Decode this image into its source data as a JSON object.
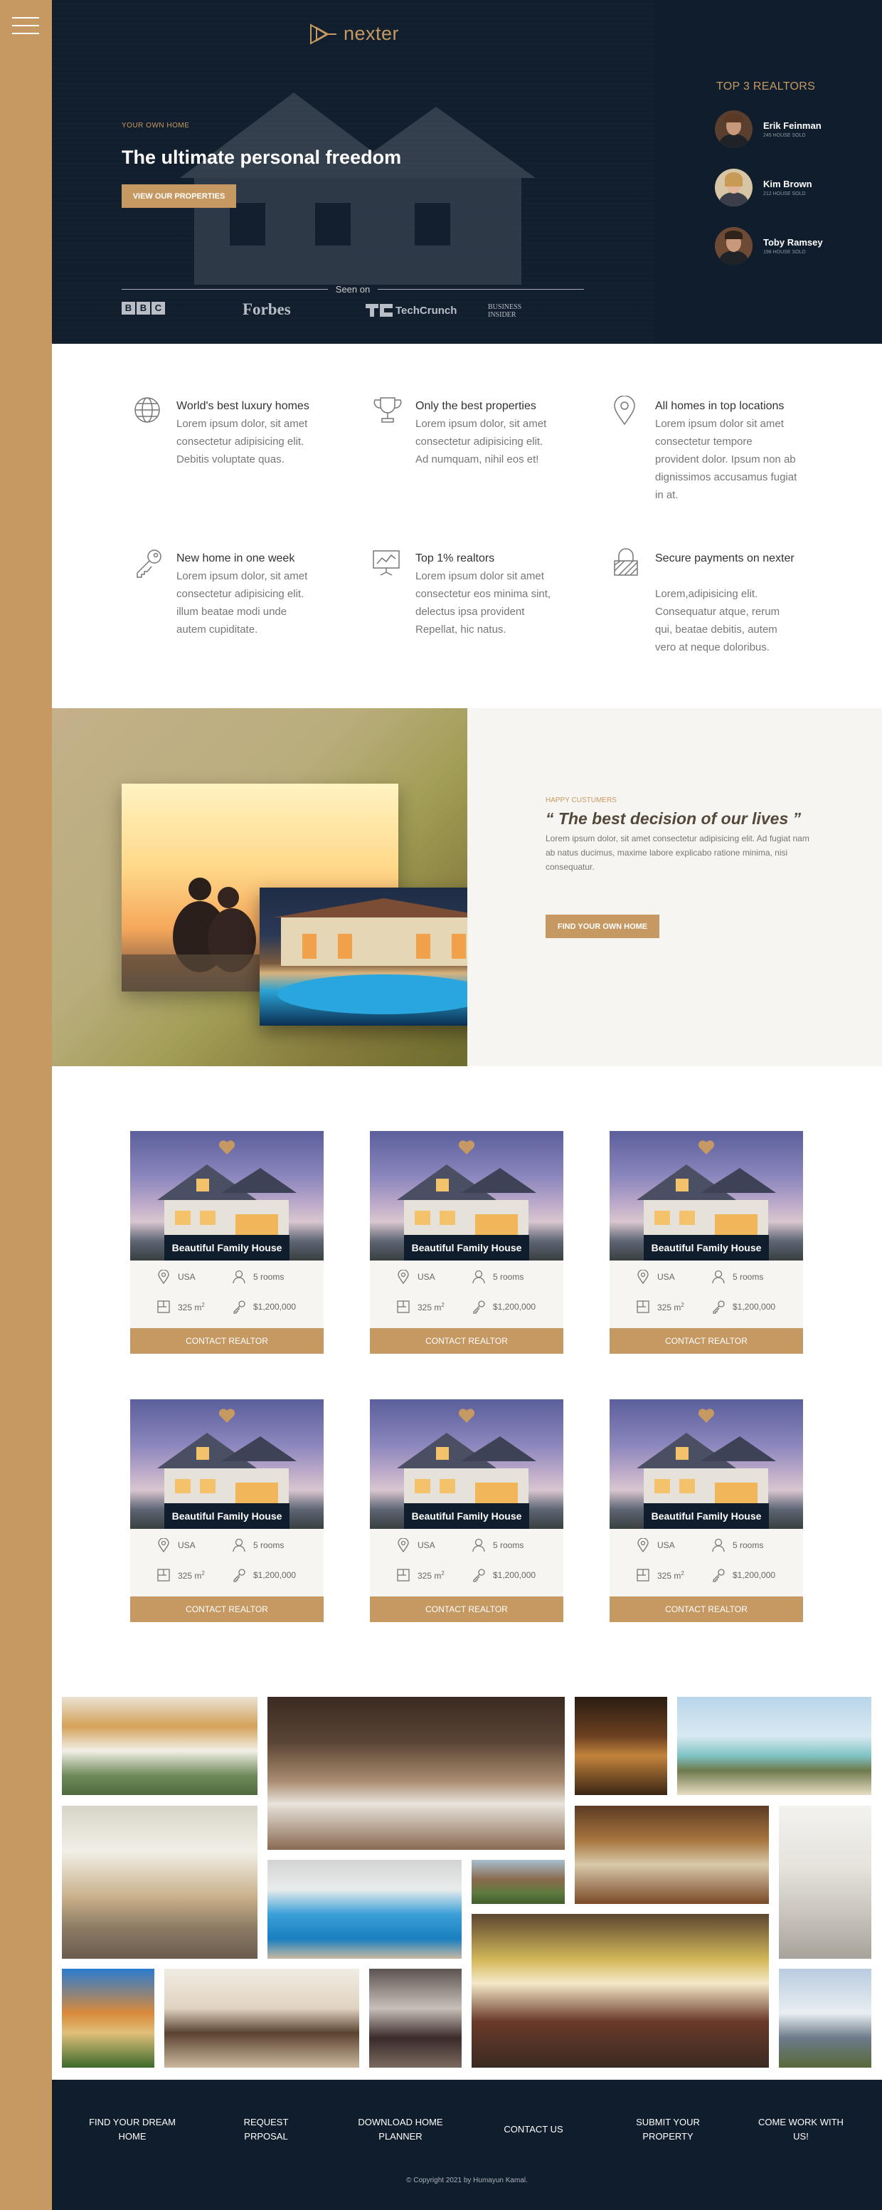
{
  "brand": {
    "name": "nexter",
    "accent": "#c69963",
    "dark": "#101d2c"
  },
  "sidebar": {
    "menu_icon": "hamburger-menu-icon"
  },
  "hero": {
    "subtitle": "YOUR OWN HOME",
    "title": "The ultimate personal freedom",
    "button": "VIEW OUR PROPERTIES",
    "seen_on": "Seen on",
    "press": {
      "bbc": [
        "B",
        "B",
        "C"
      ],
      "forbes": "Forbes",
      "techcrunch": "TechCrunch",
      "business_insider_1": "BUSINESS",
      "business_insider_2": "INSIDER"
    }
  },
  "realtors": {
    "title": "TOP 3 REALTORS",
    "items": [
      {
        "name": "Erik Feinman",
        "sold": "245 HOUSE SOLD"
      },
      {
        "name": "Kim Brown",
        "sold": "212 HOUSE SOLD"
      },
      {
        "name": "Toby Ramsey",
        "sold": "198 HOUSE SOLD"
      }
    ]
  },
  "features": [
    {
      "icon": "globe-icon",
      "title": "World's best luxury homes",
      "text": "Lorem ipsum dolor, sit amet consectetur adipisicing elit. Debitis voluptate quas."
    },
    {
      "icon": "trophy-icon",
      "title": "Only the best properties",
      "text": "Lorem ipsum dolor, sit amet consectetur adipisicing elit. Ad numquam, nihil eos et!"
    },
    {
      "icon": "map-pin-icon",
      "title": "All homes in top locations",
      "text": "Lorem ipsum dolor sit amet consectetur tempore provident dolor. Ipsum non ab dignissimos accusamus fugiat in at."
    },
    {
      "icon": "key-icon",
      "title": "New home in one week",
      "text": "Lorem ipsum dolor, sit amet consectetur adipisicing elit. illum beatae modi unde autem cupiditate."
    },
    {
      "icon": "presentation-chart-icon",
      "title": "Top 1% realtors",
      "text": "Lorem ipsum dolor sit amet consectetur eos minima sint, delectus ipsa provident Repellat, hic natus."
    },
    {
      "icon": "lock-icon",
      "title": "Secure payments on nexter",
      "text": "Lorem,adipisicing elit. Consequatur atque, rerum qui, beatae debitis, autem vero at neque doloribus."
    }
  ],
  "story": {
    "subtitle": "HAPPY CUSTUMERS",
    "title": "“ The best decision of our lives ”",
    "text": "Lorem ipsum dolor, sit amet consectetur adipisicing elit. Ad fugiat nam ab natus ducimus, maxime labore explicabo ratione minima, nisi consequatur.",
    "button": "FIND YOUR OWN HOME"
  },
  "homes": [
    {
      "name": "Beautiful Family House",
      "country": "USA",
      "rooms": "5 rooms",
      "area": "325 m",
      "area_sup": "2",
      "price": "$1,200,000",
      "button": "CONTACT REALTOR"
    },
    {
      "name": "Beautiful Family House",
      "country": "USA",
      "rooms": "5 rooms",
      "area": "325 m",
      "area_sup": "2",
      "price": "$1,200,000",
      "button": "CONTACT REALTOR"
    },
    {
      "name": "Beautiful Family House",
      "country": "USA",
      "rooms": "5 rooms",
      "area": "325 m",
      "area_sup": "2",
      "price": "$1,200,000",
      "button": "CONTACT REALTOR"
    },
    {
      "name": "Beautiful Family House",
      "country": "USA",
      "rooms": "5 rooms",
      "area": "325 m",
      "area_sup": "2",
      "price": "$1,200,000",
      "button": "CONTACT REALTOR"
    },
    {
      "name": "Beautiful Family House",
      "country": "USA",
      "rooms": "5 rooms",
      "area": "325 m",
      "area_sup": "2",
      "price": "$1,200,000",
      "button": "CONTACT REALTOR"
    },
    {
      "name": "Beautiful Family House",
      "country": "USA",
      "rooms": "5 rooms",
      "area": "325 m",
      "area_sup": "2",
      "price": "$1,200,000",
      "button": "CONTACT REALTOR"
    }
  ],
  "footer": {
    "links": [
      {
        "line1": "FIND YOUR DREAM",
        "line2": "HOME"
      },
      {
        "line1": "REQUEST",
        "line2": "PRPOSAL"
      },
      {
        "line1": "DOWNLOAD HOME",
        "line2": "PLANNER"
      },
      {
        "line1": "CONTACT US",
        "line2": ""
      },
      {
        "line1": "SUBMIT YOUR",
        "line2": "PROPERTY"
      },
      {
        "line1": "COME WORK WITH",
        "line2": "US!"
      }
    ],
    "copyright": "© Copyright 2021 by Humayun Kamal."
  }
}
